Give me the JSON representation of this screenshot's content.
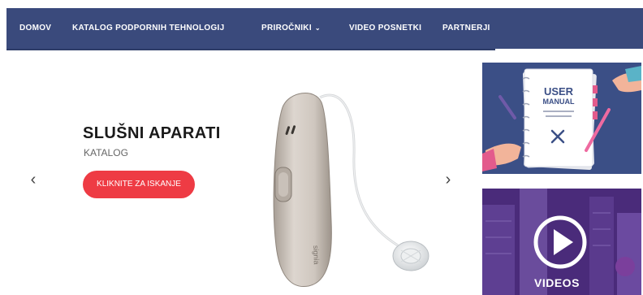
{
  "nav": {
    "home": "DOMOV",
    "catalog": "KATALOG PODPORNIH TEHNOLOGIJ",
    "guides": "PRIROČNIKI",
    "videos": "VIDEO POSNETKI",
    "partners": "PARTNERJI"
  },
  "slider": {
    "title": "SLUŠNI APARATI",
    "subtitle": "KATALOG",
    "cta": "KLIKNITE ZA ISKANJE",
    "device_brand": "signia"
  },
  "cards": {
    "manual": {
      "line1": "USER",
      "line2": "MANUAL"
    },
    "video": {
      "label": "VIDEOS"
    }
  },
  "colors": {
    "nav_bg": "#3a4a7c",
    "cta_bg": "#ee3b44",
    "manual_bg": "#3b4f86",
    "video_bg": "#4a2b7a"
  },
  "icons": {
    "prev": "chevron-left-icon",
    "next": "chevron-right-icon",
    "dropdown": "chevron-down-icon",
    "play": "play-icon"
  }
}
